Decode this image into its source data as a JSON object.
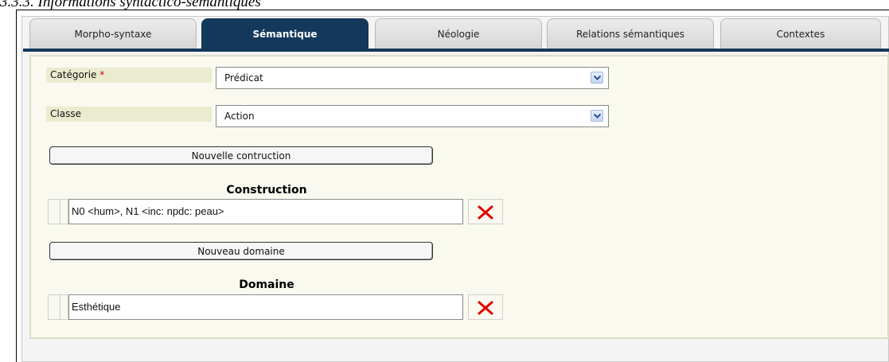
{
  "heading": "3.3.3. Informations syntactico-sémantiques",
  "tabs": [
    {
      "label": "Morpho-syntaxe",
      "active": false
    },
    {
      "label": "Sémantique",
      "active": true
    },
    {
      "label": "Néologie",
      "active": false
    },
    {
      "label": "Relations sémantiques",
      "active": false
    },
    {
      "label": "Contextes",
      "active": false
    }
  ],
  "form": {
    "categorie": {
      "label": "Catégorie",
      "required_mark": "*",
      "value": "Prédicat"
    },
    "classe": {
      "label": "Classe",
      "value": "Action"
    }
  },
  "buttons": {
    "new_construction": "Nouvelle contruction",
    "new_domain": "Nouveau domaine"
  },
  "construction": {
    "title": "Construction",
    "value": "N0 <hum>, N1 <inc: npdc: peau>"
  },
  "domaine": {
    "title": "Domaine",
    "value": "Esthétique"
  },
  "icons": {
    "select_arrow": "chevron-down-icon",
    "delete": "delete-x-icon"
  },
  "colors": {
    "active_tab": "#14385c",
    "delete_icon": "#e00000",
    "label_bg": "#ebebcf"
  }
}
